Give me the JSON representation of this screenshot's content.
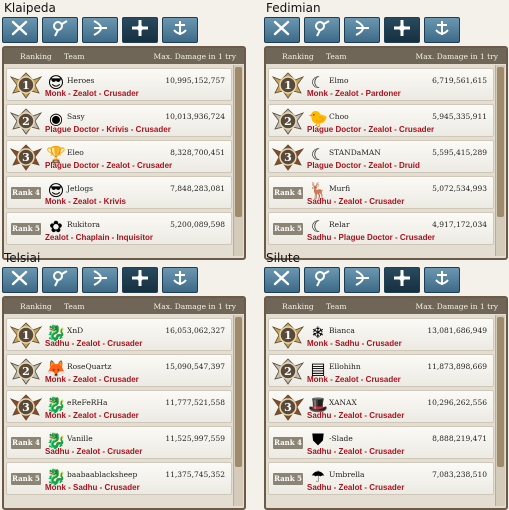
{
  "headers": {
    "ranking": "Ranking",
    "team": "Team",
    "damage": "Max. Damage in 1 try"
  },
  "colors": {
    "tab": "#5a86a2",
    "tab_active": "#1e3a4c",
    "composition": "#a8141e",
    "gold": "#c9a25a",
    "silver": "#bdbdbd",
    "bronze": "#8a4a2a"
  },
  "tabs": [
    {
      "icon": "crossed-swords-icon"
    },
    {
      "icon": "wizard-icon"
    },
    {
      "icon": "bow-icon"
    },
    {
      "icon": "cross-icon"
    },
    {
      "icon": "anchor-icon"
    }
  ],
  "active_tab": 3,
  "servers": [
    {
      "name": "Klaipeda",
      "rows": [
        {
          "rank": "1",
          "team": "Heroes",
          "damage": "10,995,152,757",
          "composition": "Monk - Zealot - Crusader",
          "icon": "sunglasses-icon"
        },
        {
          "rank": "2",
          "team": "Sasy",
          "damage": "10,013,936,724",
          "composition": "Plague Doctor - Krivis - Crusader",
          "icon": "orb-icon"
        },
        {
          "rank": "3",
          "team": "Eleo",
          "damage": "8,328,700,451",
          "composition": "Plague Doctor - Zealot - Crusader",
          "icon": "trophy-icon"
        },
        {
          "rank": "Rank 4",
          "team": "Jetlogs",
          "damage": "7,848,283,081",
          "composition": "Monk - Zealot - Krivis",
          "icon": "sunglasses-icon"
        },
        {
          "rank": "Rank 5",
          "team": "Rukitora",
          "damage": "5,200,089,598",
          "composition": "Zealot - Chaplain - Inquisitor",
          "icon": "flower-icon"
        }
      ]
    },
    {
      "name": "Fedimian",
      "rows": [
        {
          "rank": "1",
          "team": "Elmo",
          "damage": "6,719,561,615",
          "composition": "Monk - Zealot - Pardoner",
          "icon": "moon-icon"
        },
        {
          "rank": "2",
          "team": "Choo",
          "damage": "5,945,335,911",
          "composition": "Plague Doctor - Zealot - Crusader",
          "icon": "chick-icon"
        },
        {
          "rank": "3",
          "team": "STANDaMAN",
          "damage": "5,595,415,289",
          "composition": "Plague Doctor - Zealot - Druid",
          "icon": "moon-icon"
        },
        {
          "rank": "Rank 4",
          "team": "Murfi",
          "damage": "5,072,534,993",
          "composition": "Sadhu - Zealot - Crusader",
          "icon": "deer-icon"
        },
        {
          "rank": "Rank 5",
          "team": "Relar",
          "damage": "4,917,172,034",
          "composition": "Sadhu - Plague Doctor - Crusader",
          "icon": "moon-icon"
        }
      ]
    },
    {
      "name": "Telsiai",
      "rows": [
        {
          "rank": "1",
          "team": "XnD",
          "damage": "16,053,062,327",
          "composition": "Sadhu - Zealot - Crusader",
          "icon": "dragon-icon"
        },
        {
          "rank": "2",
          "team": "RoseQuartz",
          "damage": "15,090,547,397",
          "composition": "Monk - Zealot - Crusader",
          "icon": "fox-icon"
        },
        {
          "rank": "3",
          "team": "eReFeRHa",
          "damage": "11,777,521,558",
          "composition": "Monk - Zealot - Crusader",
          "icon": "dragon-icon"
        },
        {
          "rank": "Rank 4",
          "team": "Vanille",
          "damage": "11,525,997,559",
          "composition": "Sadhu - Zealot - Crusader",
          "icon": "dragon-icon"
        },
        {
          "rank": "Rank 5",
          "team": "baabaablacksheep",
          "damage": "11,375,745,352",
          "composition": "Monk - Sadhu - Crusader",
          "icon": "dragon-icon"
        }
      ]
    },
    {
      "name": "Silute",
      "rows": [
        {
          "rank": "1",
          "team": "Bianca",
          "damage": "13,081,686,949",
          "composition": "Monk - Sadhu - Crusader",
          "icon": "snowflake-icon"
        },
        {
          "rank": "2",
          "team": "Ellohihn",
          "damage": "11,873,898,669",
          "composition": "Monk - Zealot - Crusader",
          "icon": "paper-icon"
        },
        {
          "rank": "3",
          "team": "XANAX",
          "damage": "10,296,262,556",
          "composition": "Sadhu - Zealot - Crusader",
          "icon": "hat-icon"
        },
        {
          "rank": "Rank 4",
          "team": "-Slade",
          "damage": "8,888,219,471",
          "composition": "Sadhu - Zealot - Crusader",
          "icon": "shield-icon"
        },
        {
          "rank": "Rank 5",
          "team": "Umbrella",
          "damage": "7,083,238,510",
          "composition": "Sadhu - Zealot - Crusader",
          "icon": "umbrella-icon"
        }
      ]
    }
  ]
}
